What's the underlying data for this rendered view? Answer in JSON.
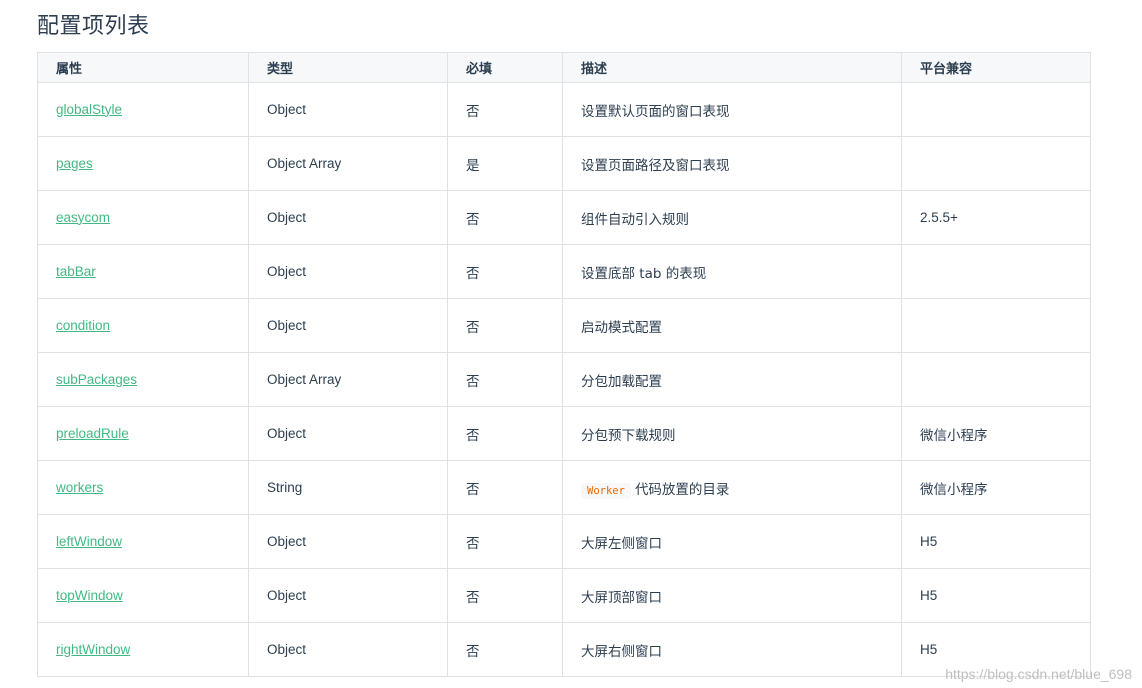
{
  "title": "配置项列表",
  "table": {
    "headers": {
      "attr": "属性",
      "type": "类型",
      "required": "必填",
      "desc": "描述",
      "platform": "平台兼容"
    },
    "rows": [
      {
        "attr": "globalStyle",
        "type": "Object",
        "required": "否",
        "desc_code": "",
        "desc": "设置默认页面的窗口表现",
        "platform": ""
      },
      {
        "attr": "pages",
        "type": "Object Array",
        "required": "是",
        "desc_code": "",
        "desc": "设置页面路径及窗口表现",
        "platform": ""
      },
      {
        "attr": "easycom",
        "type": "Object",
        "required": "否",
        "desc_code": "",
        "desc": "组件自动引入规则",
        "platform": "2.5.5+"
      },
      {
        "attr": "tabBar",
        "type": "Object",
        "required": "否",
        "desc_code": "",
        "desc": "设置底部 tab 的表现",
        "platform": ""
      },
      {
        "attr": "condition",
        "type": "Object",
        "required": "否",
        "desc_code": "",
        "desc": "启动模式配置",
        "platform": ""
      },
      {
        "attr": "subPackages",
        "type": "Object Array",
        "required": "否",
        "desc_code": "",
        "desc": "分包加载配置",
        "platform": ""
      },
      {
        "attr": "preloadRule",
        "type": "Object",
        "required": "否",
        "desc_code": "",
        "desc": "分包预下载规则",
        "platform": "微信小程序"
      },
      {
        "attr": "workers",
        "type": "String",
        "required": "否",
        "desc_code": "Worker",
        "desc": "代码放置的目录",
        "platform": "微信小程序"
      },
      {
        "attr": "leftWindow",
        "type": "Object",
        "required": "否",
        "desc_code": "",
        "desc": "大屏左侧窗口",
        "platform": "H5"
      },
      {
        "attr": "topWindow",
        "type": "Object",
        "required": "否",
        "desc_code": "",
        "desc": "大屏顶部窗口",
        "platform": "H5"
      },
      {
        "attr": "rightWindow",
        "type": "Object",
        "required": "否",
        "desc_code": "",
        "desc": "大屏右侧窗口",
        "platform": "H5"
      }
    ]
  },
  "watermark": "https://blog.csdn.net/blue_698",
  "colors": {
    "link": "#42b983",
    "code": "#e96900",
    "border": "#dfe2e5",
    "header_bg": "#f6f8fa"
  }
}
